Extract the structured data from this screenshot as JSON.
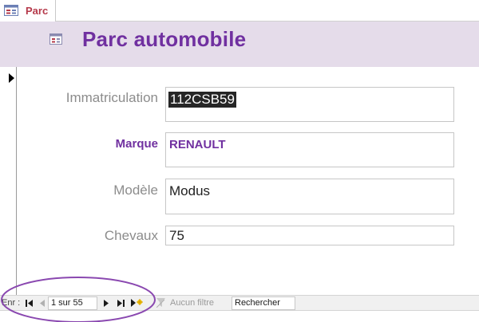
{
  "tab": {
    "label": "Parc"
  },
  "header": {
    "title": "Parc automobile"
  },
  "fields": [
    {
      "label": "Immatriculation",
      "value": "112CSB59"
    },
    {
      "label": "Marque",
      "value": "RENAULT"
    },
    {
      "label": "Modèle",
      "value": "Modus"
    },
    {
      "label": "Chevaux",
      "value": "75"
    }
  ],
  "navigation": {
    "label": "Enr :",
    "record_position": "1 sur 55",
    "filter_status": "Aucun filtre",
    "search_placeholder": "Rechercher"
  },
  "colors": {
    "accent": "#7030a0",
    "header_band": "#e5dcea",
    "tab_text": "#b5394a"
  },
  "icons": [
    "form-icon",
    "record-selector-arrow-icon",
    "first-record-icon",
    "previous-record-icon",
    "next-record-icon",
    "last-record-icon",
    "new-record-icon",
    "filter-icon"
  ]
}
